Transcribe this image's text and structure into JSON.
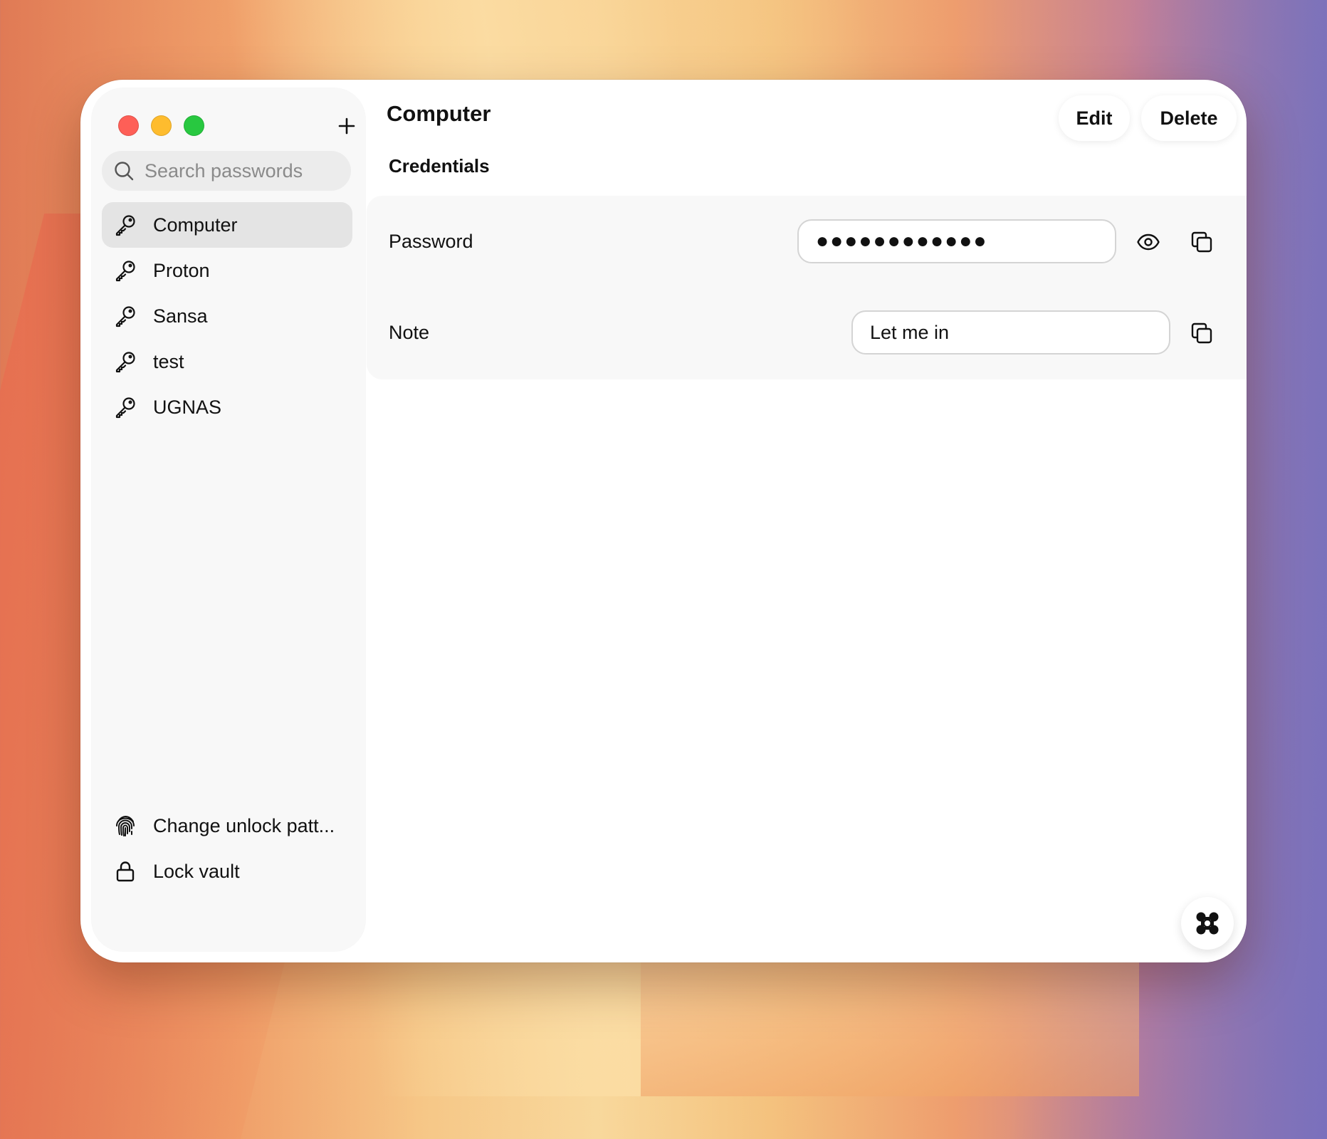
{
  "window": {
    "traffic_lights": [
      "close",
      "minimize",
      "zoom"
    ]
  },
  "sidebar": {
    "add_icon": "plus-icon",
    "search": {
      "placeholder": "Search passwords",
      "value": ""
    },
    "items": [
      {
        "label": "Computer",
        "icon": "key-icon",
        "selected": true
      },
      {
        "label": "Proton",
        "icon": "key-icon",
        "selected": false
      },
      {
        "label": "Sansa",
        "icon": "key-icon",
        "selected": false
      },
      {
        "label": "test",
        "icon": "key-icon",
        "selected": false
      },
      {
        "label": "UGNAS",
        "icon": "key-icon",
        "selected": false
      }
    ],
    "footer": [
      {
        "label": "Change unlock patt...",
        "icon": "fingerprint-icon"
      },
      {
        "label": "Lock vault",
        "icon": "lock-icon"
      }
    ]
  },
  "main": {
    "title": "Computer",
    "edit_label": "Edit",
    "delete_label": "Delete",
    "section_title": "Credentials",
    "fields": {
      "password": {
        "label": "Password",
        "value": "●●●●●●●●●●●●"
      },
      "note": {
        "label": "Note",
        "value": "Let me in"
      }
    },
    "fab_icon": "app-grid-icon"
  },
  "colors": {
    "selected_item_bg": "#e4e4e4",
    "sidebar_bg": "#f8f8f8",
    "card_bg": "#f8f8f8",
    "close": "#fe5f57",
    "minimize": "#febc2e",
    "zoom": "#28c840"
  }
}
